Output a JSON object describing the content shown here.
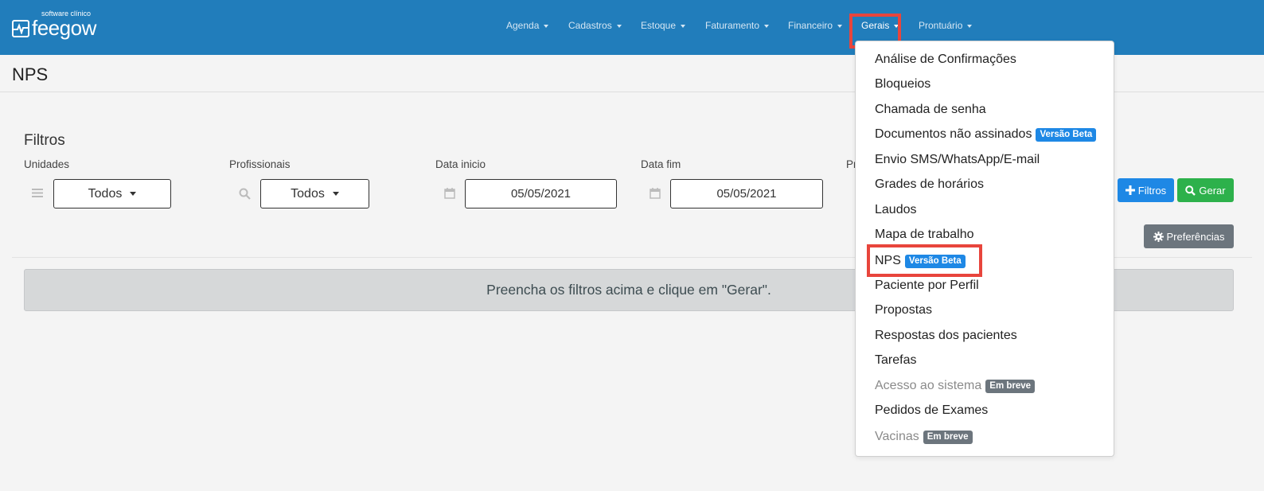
{
  "brand": {
    "sub": "software clínico",
    "name": "feegow"
  },
  "nav": {
    "items": [
      {
        "label": "Agenda"
      },
      {
        "label": "Cadastros"
      },
      {
        "label": "Estoque"
      },
      {
        "label": "Faturamento"
      },
      {
        "label": "Financeiro"
      },
      {
        "label": "Gerais"
      },
      {
        "label": "Prontuário"
      }
    ],
    "active": "Gerais"
  },
  "page": {
    "title": "NPS"
  },
  "filters": {
    "title": "Filtros",
    "unidades": {
      "label": "Unidades",
      "value": "Todos"
    },
    "profissionais": {
      "label": "Profissionais",
      "value": "Todos"
    },
    "data_inicio": {
      "label": "Data inicio",
      "value": "05/05/2021"
    },
    "data_fim": {
      "label": "Data fim",
      "value": "05/05/2021"
    },
    "partial_label": "Pr"
  },
  "buttons": {
    "filtros": "Filtros",
    "gerar": "Gerar",
    "preferencias": "Preferências"
  },
  "alert": {
    "text": "Preencha os filtros acima e clique em \"Gerar\"."
  },
  "dropdown": {
    "items": [
      {
        "label": "Análise de Confirmações"
      },
      {
        "label": "Bloqueios"
      },
      {
        "label": "Chamada de senha"
      },
      {
        "label": "Documentos não assinados",
        "badge": "Versão Beta"
      },
      {
        "label": "Envio SMS/WhatsApp/E-mail"
      },
      {
        "label": "Grades de horários"
      },
      {
        "label": "Laudos"
      },
      {
        "label": "Mapa de trabalho"
      },
      {
        "label": "NPS",
        "badge": "Versão Beta"
      },
      {
        "label": "Paciente por Perfil"
      },
      {
        "label": "Propostas"
      },
      {
        "label": "Respostas dos pacientes"
      },
      {
        "label": "Tarefas"
      },
      {
        "label": "Acesso ao sistema",
        "badge": "Em breve"
      },
      {
        "label": "Pedidos de Exames"
      },
      {
        "label": "Vacinas",
        "badge": "Em breve"
      }
    ]
  },
  "colors": {
    "navbar": "#217dbb",
    "highlight": "#e8453c",
    "badge_beta": "#1e88e5",
    "badge_soon": "#6c757d",
    "btn_primary": "#1e88e5",
    "btn_success": "#2db14b"
  },
  "icons": {
    "unidades": "list-icon",
    "profissionais": "search-icon",
    "data_inicio": "calendar-icon",
    "data_fim": "calendar-icon"
  }
}
